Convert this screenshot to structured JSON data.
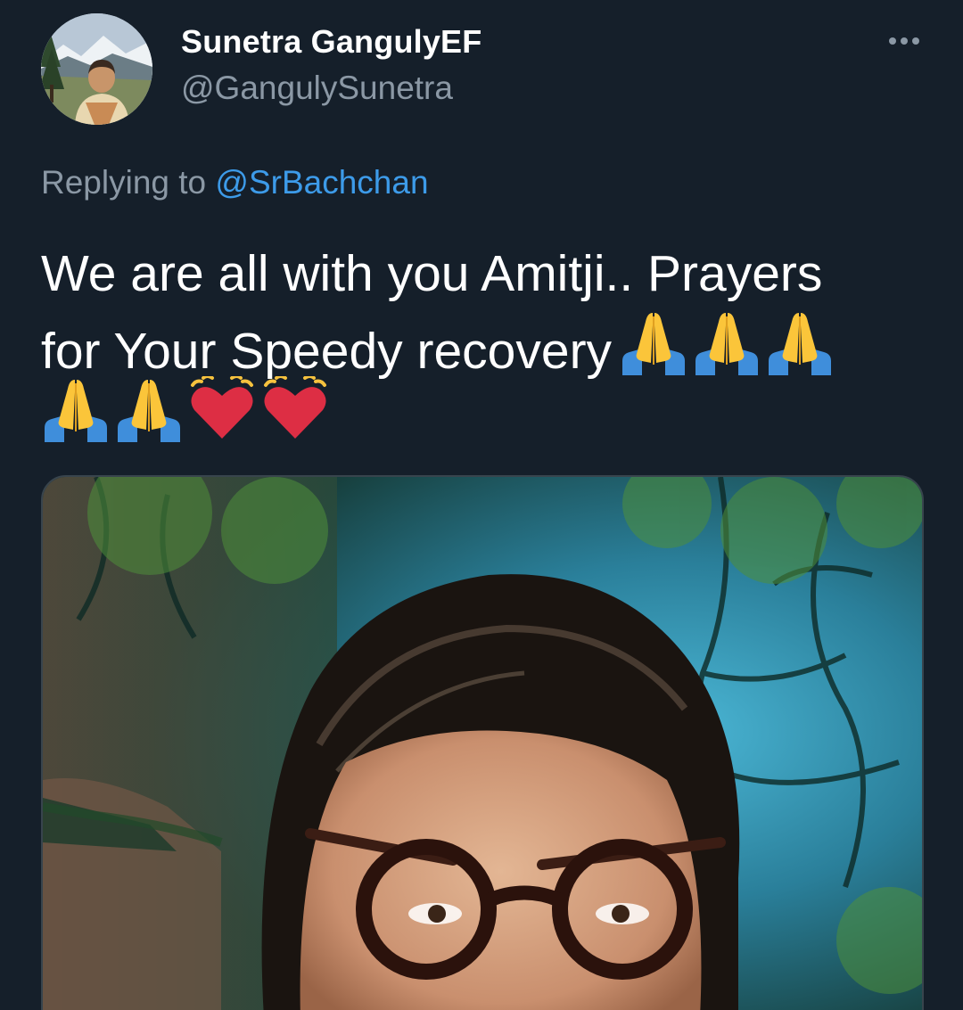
{
  "tweet": {
    "author_name": "Sunetra GangulyEF",
    "author_handle": "@GangulySunetra",
    "reply_prefix": "Replying to",
    "reply_mention": "@SrBachchan",
    "text_line1": "We are all with you Amitji.. Prayers",
    "text_line2": "for Your Speedy recovery",
    "emojis_line2": [
      "folded-hands",
      "folded-hands",
      "folded-hands"
    ],
    "emojis_line3": [
      "folded-hands",
      "folded-hands",
      "growing-heart",
      "growing-heart"
    ]
  },
  "icons": {
    "more": "more-horizontal-icon"
  },
  "colors": {
    "background": "#151f2a",
    "text": "#ffffff",
    "secondary": "#8b98a5",
    "link": "#3d9be9"
  }
}
